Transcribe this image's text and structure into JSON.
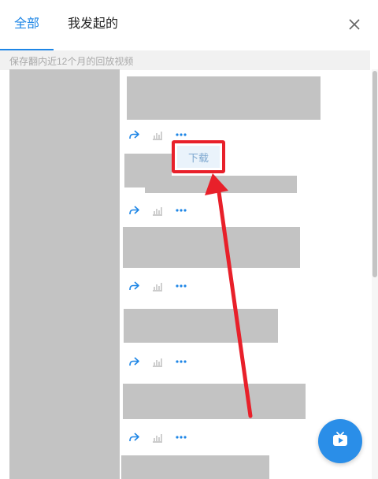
{
  "tabs": [
    {
      "label": "全部",
      "active": true
    },
    {
      "label": "我发起的",
      "active": false
    }
  ],
  "notice": "保存翻内近12个月的回放视频",
  "menu": {
    "download_label": "下载"
  },
  "icons": {
    "close": "close-icon",
    "share": "share-icon",
    "stats": "bar-chart-icon",
    "more": "more-icon",
    "fab": "video-tv-icon"
  },
  "colors": {
    "accent": "#1e86e6",
    "highlight": "#e8202a",
    "placeholder": "#c3c3c3"
  }
}
